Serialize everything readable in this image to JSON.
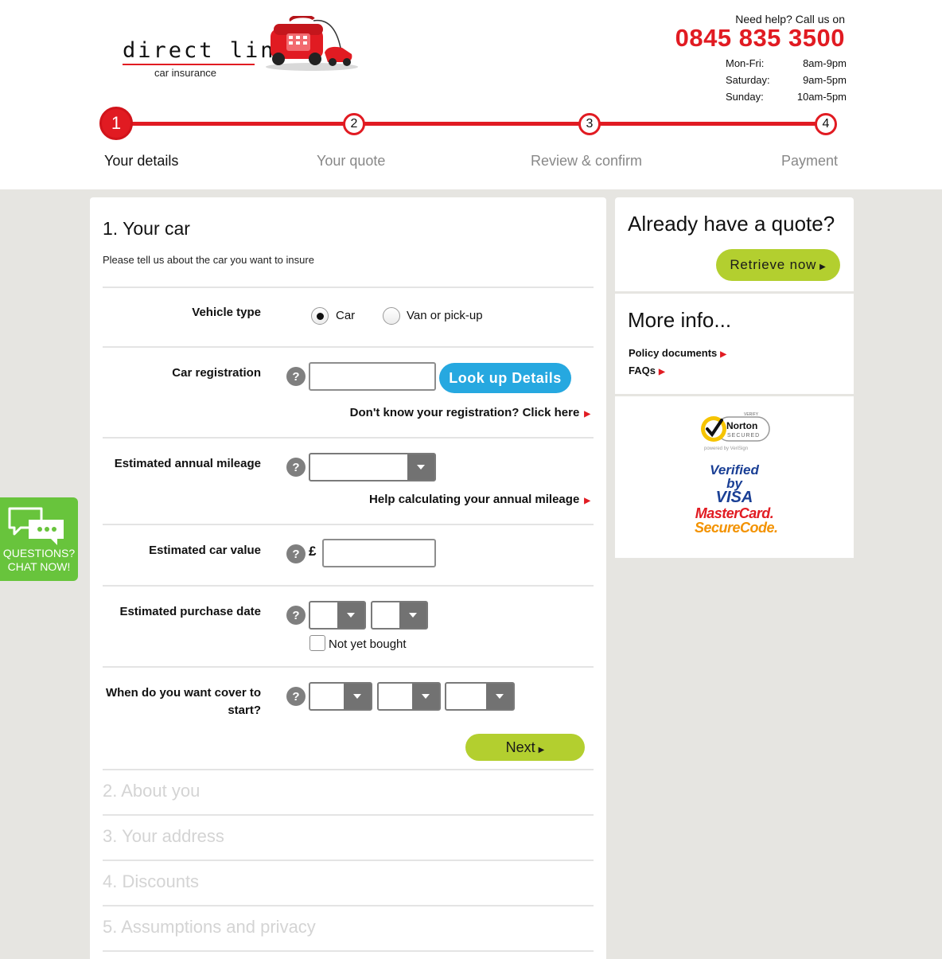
{
  "brand": {
    "name": "direct line",
    "subtitle": "car insurance"
  },
  "help": {
    "label": "Need help? Call us on",
    "phone": "0845 835 3500",
    "hours": [
      {
        "day": "Mon-Fri:",
        "time": "8am-9pm"
      },
      {
        "day": "Saturday:",
        "time": "9am-5pm"
      },
      {
        "day": "Sunday:",
        "time": "10am-5pm"
      }
    ]
  },
  "progress": {
    "current_step": 1,
    "steps": [
      {
        "number": "1",
        "label": "Your details"
      },
      {
        "number": "2",
        "label": "Your quote"
      },
      {
        "number": "3",
        "label": "Review & confirm"
      },
      {
        "number": "4",
        "label": "Payment"
      }
    ]
  },
  "form": {
    "title": "1. Your car",
    "subtitle": "Please tell us about the car you want to insure",
    "vehicle_type": {
      "label": "Vehicle type",
      "options": [
        "Car",
        "Van or pick-up"
      ],
      "selected": "Car"
    },
    "registration": {
      "label": "Car registration",
      "value": "",
      "lookup_button": "Look up Details",
      "help_link": "Don't know your registration? Click here"
    },
    "mileage": {
      "label": "Estimated annual mileage",
      "value": "",
      "help_link": "Help calculating your annual mileage"
    },
    "car_value": {
      "label": "Estimated car value",
      "currency": "£",
      "value": ""
    },
    "purchase_date": {
      "label": "Estimated purchase date",
      "month": "",
      "year": "",
      "not_yet_bought_label": "Not yet bought",
      "not_yet_bought_checked": false
    },
    "cover_start": {
      "label_line1": "When do you want cover to",
      "label_line2": "start?",
      "day": "",
      "month": "",
      "year": ""
    },
    "next_button": "Next",
    "help_icon_glyph": "?"
  },
  "collapsed_sections": [
    "2. About you",
    "3. Your address",
    "4. Discounts",
    "5. Assumptions and privacy"
  ],
  "sidebar": {
    "quote_title": "Already have a quote?",
    "retrieve_button": "Retrieve now",
    "more_info_title": "More info...",
    "links": [
      "Policy documents",
      "FAQs"
    ],
    "security_badges": {
      "norton_small": "VERIFY",
      "norton_main": "Norton",
      "norton_secured": "SECURED",
      "norton_powered": "powered by VeriSign",
      "visa_top": "Verified by",
      "visa_bottom": "VISA",
      "mc_top": "MasterCard.",
      "mc_bottom": "SecureCode."
    }
  },
  "chat": {
    "line1": "QUESTIONS?",
    "line2": "CHAT NOW!"
  },
  "colors": {
    "brand_red": "#e11b22",
    "accent_green": "#b3cf2f",
    "lookup_blue": "#26a8e0",
    "chat_green": "#68c43c",
    "background": "#e6e5e1"
  }
}
